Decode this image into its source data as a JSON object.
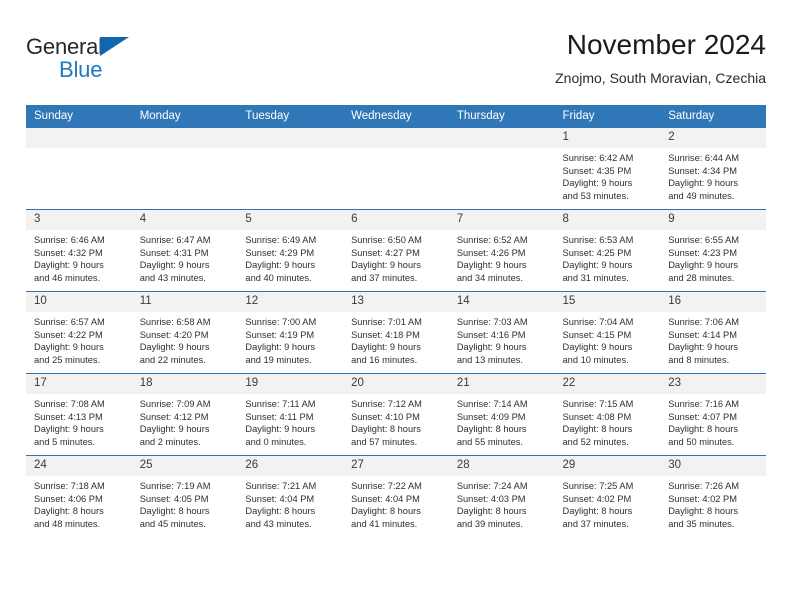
{
  "brand": {
    "general": "General",
    "blue": "Blue",
    "triangle_color": "#1067ae",
    "blue_color": "#1f7ac0"
  },
  "header": {
    "title": "November 2024",
    "subtitle": "Znojmo, South Moravian, Czechia"
  },
  "theme": {
    "header_bg": "#3077b8",
    "daynum_bg": "#f2f2f2",
    "row_border": "#2e73b1"
  },
  "weekdays": [
    "Sunday",
    "Monday",
    "Tuesday",
    "Wednesday",
    "Thursday",
    "Friday",
    "Saturday"
  ],
  "weeks": [
    [
      {
        "day": "",
        "sunrise": "",
        "sunset": "",
        "daylight1": "",
        "daylight2": ""
      },
      {
        "day": "",
        "sunrise": "",
        "sunset": "",
        "daylight1": "",
        "daylight2": ""
      },
      {
        "day": "",
        "sunrise": "",
        "sunset": "",
        "daylight1": "",
        "daylight2": ""
      },
      {
        "day": "",
        "sunrise": "",
        "sunset": "",
        "daylight1": "",
        "daylight2": ""
      },
      {
        "day": "",
        "sunrise": "",
        "sunset": "",
        "daylight1": "",
        "daylight2": ""
      },
      {
        "day": "1",
        "sunrise": "Sunrise: 6:42 AM",
        "sunset": "Sunset: 4:35 PM",
        "daylight1": "Daylight: 9 hours",
        "daylight2": "and 53 minutes."
      },
      {
        "day": "2",
        "sunrise": "Sunrise: 6:44 AM",
        "sunset": "Sunset: 4:34 PM",
        "daylight1": "Daylight: 9 hours",
        "daylight2": "and 49 minutes."
      }
    ],
    [
      {
        "day": "3",
        "sunrise": "Sunrise: 6:46 AM",
        "sunset": "Sunset: 4:32 PM",
        "daylight1": "Daylight: 9 hours",
        "daylight2": "and 46 minutes."
      },
      {
        "day": "4",
        "sunrise": "Sunrise: 6:47 AM",
        "sunset": "Sunset: 4:31 PM",
        "daylight1": "Daylight: 9 hours",
        "daylight2": "and 43 minutes."
      },
      {
        "day": "5",
        "sunrise": "Sunrise: 6:49 AM",
        "sunset": "Sunset: 4:29 PM",
        "daylight1": "Daylight: 9 hours",
        "daylight2": "and 40 minutes."
      },
      {
        "day": "6",
        "sunrise": "Sunrise: 6:50 AM",
        "sunset": "Sunset: 4:27 PM",
        "daylight1": "Daylight: 9 hours",
        "daylight2": "and 37 minutes."
      },
      {
        "day": "7",
        "sunrise": "Sunrise: 6:52 AM",
        "sunset": "Sunset: 4:26 PM",
        "daylight1": "Daylight: 9 hours",
        "daylight2": "and 34 minutes."
      },
      {
        "day": "8",
        "sunrise": "Sunrise: 6:53 AM",
        "sunset": "Sunset: 4:25 PM",
        "daylight1": "Daylight: 9 hours",
        "daylight2": "and 31 minutes."
      },
      {
        "day": "9",
        "sunrise": "Sunrise: 6:55 AM",
        "sunset": "Sunset: 4:23 PM",
        "daylight1": "Daylight: 9 hours",
        "daylight2": "and 28 minutes."
      }
    ],
    [
      {
        "day": "10",
        "sunrise": "Sunrise: 6:57 AM",
        "sunset": "Sunset: 4:22 PM",
        "daylight1": "Daylight: 9 hours",
        "daylight2": "and 25 minutes."
      },
      {
        "day": "11",
        "sunrise": "Sunrise: 6:58 AM",
        "sunset": "Sunset: 4:20 PM",
        "daylight1": "Daylight: 9 hours",
        "daylight2": "and 22 minutes."
      },
      {
        "day": "12",
        "sunrise": "Sunrise: 7:00 AM",
        "sunset": "Sunset: 4:19 PM",
        "daylight1": "Daylight: 9 hours",
        "daylight2": "and 19 minutes."
      },
      {
        "day": "13",
        "sunrise": "Sunrise: 7:01 AM",
        "sunset": "Sunset: 4:18 PM",
        "daylight1": "Daylight: 9 hours",
        "daylight2": "and 16 minutes."
      },
      {
        "day": "14",
        "sunrise": "Sunrise: 7:03 AM",
        "sunset": "Sunset: 4:16 PM",
        "daylight1": "Daylight: 9 hours",
        "daylight2": "and 13 minutes."
      },
      {
        "day": "15",
        "sunrise": "Sunrise: 7:04 AM",
        "sunset": "Sunset: 4:15 PM",
        "daylight1": "Daylight: 9 hours",
        "daylight2": "and 10 minutes."
      },
      {
        "day": "16",
        "sunrise": "Sunrise: 7:06 AM",
        "sunset": "Sunset: 4:14 PM",
        "daylight1": "Daylight: 9 hours",
        "daylight2": "and 8 minutes."
      }
    ],
    [
      {
        "day": "17",
        "sunrise": "Sunrise: 7:08 AM",
        "sunset": "Sunset: 4:13 PM",
        "daylight1": "Daylight: 9 hours",
        "daylight2": "and 5 minutes."
      },
      {
        "day": "18",
        "sunrise": "Sunrise: 7:09 AM",
        "sunset": "Sunset: 4:12 PM",
        "daylight1": "Daylight: 9 hours",
        "daylight2": "and 2 minutes."
      },
      {
        "day": "19",
        "sunrise": "Sunrise: 7:11 AM",
        "sunset": "Sunset: 4:11 PM",
        "daylight1": "Daylight: 9 hours",
        "daylight2": "and 0 minutes."
      },
      {
        "day": "20",
        "sunrise": "Sunrise: 7:12 AM",
        "sunset": "Sunset: 4:10 PM",
        "daylight1": "Daylight: 8 hours",
        "daylight2": "and 57 minutes."
      },
      {
        "day": "21",
        "sunrise": "Sunrise: 7:14 AM",
        "sunset": "Sunset: 4:09 PM",
        "daylight1": "Daylight: 8 hours",
        "daylight2": "and 55 minutes."
      },
      {
        "day": "22",
        "sunrise": "Sunrise: 7:15 AM",
        "sunset": "Sunset: 4:08 PM",
        "daylight1": "Daylight: 8 hours",
        "daylight2": "and 52 minutes."
      },
      {
        "day": "23",
        "sunrise": "Sunrise: 7:16 AM",
        "sunset": "Sunset: 4:07 PM",
        "daylight1": "Daylight: 8 hours",
        "daylight2": "and 50 minutes."
      }
    ],
    [
      {
        "day": "24",
        "sunrise": "Sunrise: 7:18 AM",
        "sunset": "Sunset: 4:06 PM",
        "daylight1": "Daylight: 8 hours",
        "daylight2": "and 48 minutes."
      },
      {
        "day": "25",
        "sunrise": "Sunrise: 7:19 AM",
        "sunset": "Sunset: 4:05 PM",
        "daylight1": "Daylight: 8 hours",
        "daylight2": "and 45 minutes."
      },
      {
        "day": "26",
        "sunrise": "Sunrise: 7:21 AM",
        "sunset": "Sunset: 4:04 PM",
        "daylight1": "Daylight: 8 hours",
        "daylight2": "and 43 minutes."
      },
      {
        "day": "27",
        "sunrise": "Sunrise: 7:22 AM",
        "sunset": "Sunset: 4:04 PM",
        "daylight1": "Daylight: 8 hours",
        "daylight2": "and 41 minutes."
      },
      {
        "day": "28",
        "sunrise": "Sunrise: 7:24 AM",
        "sunset": "Sunset: 4:03 PM",
        "daylight1": "Daylight: 8 hours",
        "daylight2": "and 39 minutes."
      },
      {
        "day": "29",
        "sunrise": "Sunrise: 7:25 AM",
        "sunset": "Sunset: 4:02 PM",
        "daylight1": "Daylight: 8 hours",
        "daylight2": "and 37 minutes."
      },
      {
        "day": "30",
        "sunrise": "Sunrise: 7:26 AM",
        "sunset": "Sunset: 4:02 PM",
        "daylight1": "Daylight: 8 hours",
        "daylight2": "and 35 minutes."
      }
    ]
  ]
}
